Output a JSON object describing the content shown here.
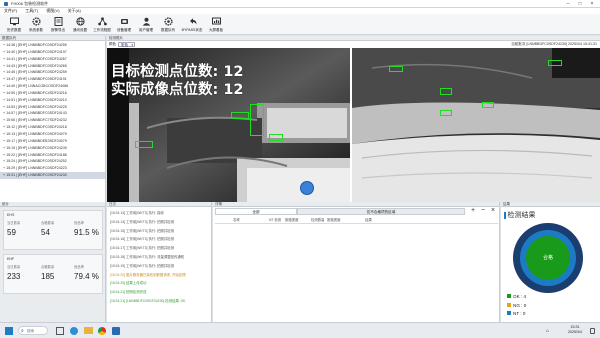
{
  "window": {
    "title": "FH006 包装检测软件"
  },
  "menu": [
    "文件(F)",
    "工具(T)",
    "视图(V)",
    "关于(A)"
  ],
  "toolbar": [
    {
      "label": "历史数据",
      "icon": "monitor-icon"
    },
    {
      "label": "系统参数",
      "icon": "gear-icon"
    },
    {
      "label": "报警导出",
      "icon": "list-icon"
    },
    {
      "label": "通讯设置",
      "icon": "globe-icon"
    },
    {
      "label": "工作流程图",
      "icon": "network-icon"
    },
    {
      "label": "设备管理",
      "icon": "device-icon"
    },
    {
      "label": "用户管理",
      "icon": "user-icon"
    },
    {
      "label": "数据队列",
      "icon": "gear-icon"
    },
    {
      "label": "BYPASS状态",
      "icon": "undo-icon"
    },
    {
      "label": "大屏看板",
      "icon": "dashboard-icon"
    }
  ],
  "left_panel": {
    "header": "数据队列",
    "rows": [
      "+ 14:38 | [EHF] LNNBBDFC0SDF24259",
      "+ 14:40 | [EHF] LNNBBDFC0SDF24197",
      "+ 14:41 | [EHF] LNNBBDFC0SDF24267",
      "+ 14:43 | [EHF] LNNBBDFC0SDF24265",
      "+ 14:45 | [EHF] LNNBBDFC0SDF24259",
      "+ 14:47 | [EHF] LNNBBDFC0SDF24191",
      "+ 14:49 | [EHF] LNNACOBCOSDF24086",
      "+ 14:50 | [EHF] LNNBBDFC4SDF24216",
      "+ 14:51 | [EHF] LNNBBDFC0SDF24210",
      "+ 14:53 | [EHF] LNNBBDFC0SDF24225",
      "+ 14:57 | [EHF] LNNBBDFC0SDF24143",
      "+ 15:06 | [EHF] LNNBBDFC7SDF24232",
      "+ 15:12 | [EHF] LNNBBDFC0SDF24218",
      "+ 15:13 | [EHF] LNNBBDFC0SDF24079",
      "+ 15:17 | [EHF] LNNBBDEB3SDF24079",
      "+ 15:19 | [EHF] LNNBBDFC0SDF24249",
      "+ 15:22 | [EHF] LNNBBDFC0SDF24186",
      "+ 15:24 | [EHF] LNNBBDFC0SDF24252",
      "+ 15:29 | [EHF] LNNBBDFC0SDF24223",
      "+ 15:31 | [EHF] LNNBBDFC0SDF24230"
    ]
  },
  "center": {
    "header": "检测照片",
    "select_label": "颜色",
    "select_value": "彩色",
    "vin_label": "当前批次 [LNNBBDFC0SDF24230] 2025/3/4 15:31:31",
    "overlay_line1": "目标检测点位数: 12",
    "overlay_line2": "实际成像点位数: 12"
  },
  "stats": {
    "header": "统计",
    "cards": [
      {
        "name": "EHS",
        "labels": [
          "当日数量",
          "合格数量",
          "良品率"
        ],
        "values": [
          "59",
          "54",
          "91.5 %"
        ]
      },
      {
        "name": "EHF",
        "labels": [
          "当日数量",
          "合格数量",
          "良品率"
        ],
        "values": [
          "233",
          "185",
          "79.4 %"
        ]
      }
    ]
  },
  "log": {
    "header": "日志",
    "lines": [
      {
        "text": "[15:31:14] 工作用[WKT3] 执行: 接收",
        "color": "#555"
      },
      {
        "text": "[15:31:14] 工作用[WKT3] 执行: 拍照并检测",
        "color": "#555"
      },
      {
        "text": "[15:31:15] 工作用[WKT3] 执行: 拍照并检测",
        "color": "#555"
      },
      {
        "text": "[15:31:16] 工作用[WKT3] 执行: 拍照并检测",
        "color": "#555"
      },
      {
        "text": "[15:31:17] 工作用[WKT3] 执行: 拍照并检测",
        "color": "#555"
      },
      {
        "text": "[15:31:18] 工作用[WKT3] 执行: 流量调整回传通知",
        "color": "#555"
      },
      {
        "text": "[15:31:19] 工作用[WKT3] 执行: 拍照并检测",
        "color": "#555"
      },
      {
        "text": "[15:31:20] 图片服务器已接收到数据请求, 开始处理",
        "color": "#c98b1b"
      },
      {
        "text": "[15:31:20] 结果上传成功",
        "color": "#3a9a3a"
      },
      {
        "text": "[15:31:21] 拍照检测完成",
        "color": "#3a9a3a"
      },
      {
        "text": "[15:31:21] [LNNBBDFC0SDF24230] 检测结果: OK",
        "color": "#3a9a3a"
      }
    ]
  },
  "detail": {
    "header": "详情",
    "tab_all": "全部",
    "tab_other": "仅不合格项的区域",
    "plus": "+",
    "minus": "−",
    "close": "×",
    "columns": [
      "名称",
      "NT 检测",
      "胶路宽度",
      "检测数量",
      "胶路宽度",
      "结果"
    ]
  },
  "result": {
    "header": "结果",
    "title": "检测结果",
    "center_label": "合格",
    "legend": [
      {
        "label": "OK : 4",
        "color": "#1a9a1a"
      },
      {
        "label": "NG : 0",
        "color": "#e8a118"
      },
      {
        "label": "NT : 0",
        "color": "#1d7bc6"
      }
    ]
  },
  "taskbar": {
    "search_placeholder": "搜索",
    "time": "15:31",
    "date": "2025/3/4"
  }
}
